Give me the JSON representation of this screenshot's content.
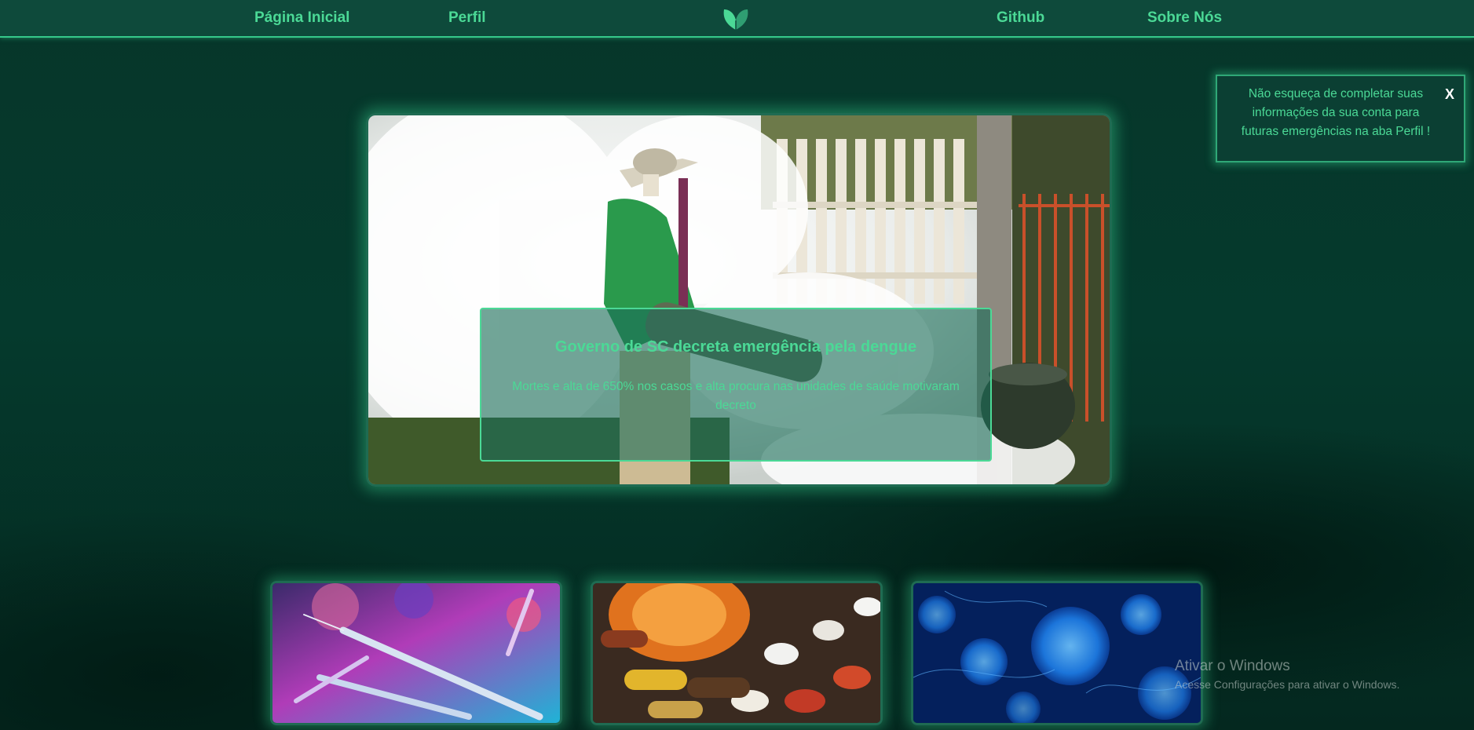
{
  "nav": {
    "home": "Página Inicial",
    "profile": "Perfil",
    "github": "Github",
    "about": "Sobre Nós",
    "logo_icon": "leaf-heart-icon"
  },
  "hero": {
    "title": "Governo de SC decreta emergência pela dengue",
    "description": "Mortes e alta de 650% nos casos e alta procura nas unidades de saúde motivaram decreto"
  },
  "toast": {
    "message": "Não esqueça de completar suas informações da sua conta para futuras emergências na aba Perfil !",
    "close_label": "X"
  },
  "cards": [
    {
      "image": "syringes-image"
    },
    {
      "image": "pills-image"
    },
    {
      "image": "cells-image"
    }
  ],
  "watermark": {
    "title": "Ativar o Windows",
    "subtitle": "Acesse Configurações para ativar o Windows."
  },
  "colors": {
    "accent": "#4bd996",
    "nav_bg": "#0e4a3b",
    "page_bg": "#053a2d"
  }
}
